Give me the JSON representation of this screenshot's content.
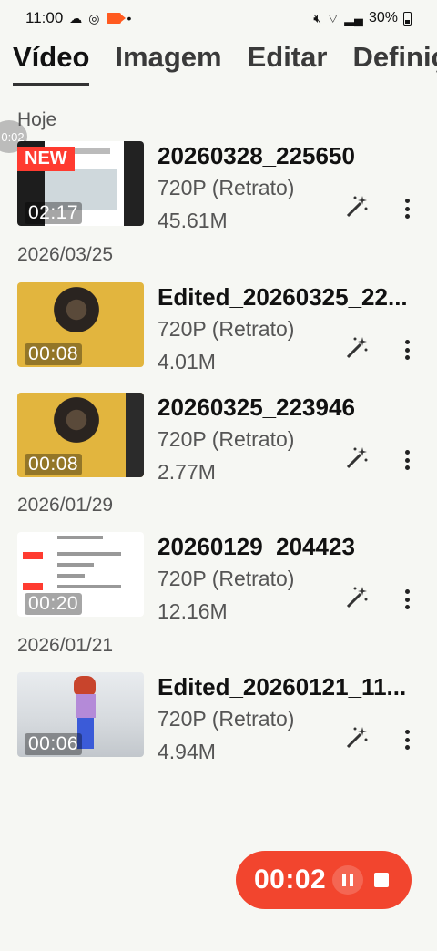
{
  "status": {
    "time": "11:00",
    "battery": "30%"
  },
  "tabs": [
    "Vídeo",
    "Imagem",
    "Editar",
    "Definições"
  ],
  "float_timer": "0:02",
  "sections": [
    {
      "date": "Hoje",
      "items": [
        {
          "name": "20260328_225650",
          "resolution": "720P (Retrato)",
          "size": "45.61M",
          "duration": "02:17",
          "badge": "NEW"
        }
      ]
    },
    {
      "date": "2026/03/25",
      "items": [
        {
          "name": "Edited_20260325_22...",
          "resolution": "720P (Retrato)",
          "size": "4.01M",
          "duration": "00:08"
        },
        {
          "name": "20260325_223946",
          "resolution": "720P (Retrato)",
          "size": "2.77M",
          "duration": "00:08"
        }
      ]
    },
    {
      "date": "2026/01/29",
      "items": [
        {
          "name": "20260129_204423",
          "resolution": "720P (Retrato)",
          "size": "12.16M",
          "duration": "00:20"
        }
      ]
    },
    {
      "date": "2026/01/21",
      "items": [
        {
          "name": "Edited_20260121_11...",
          "resolution": "720P (Retrato)",
          "size": "4.94M",
          "duration": "00:06"
        }
      ]
    }
  ],
  "recorder": {
    "time": "00:02"
  }
}
